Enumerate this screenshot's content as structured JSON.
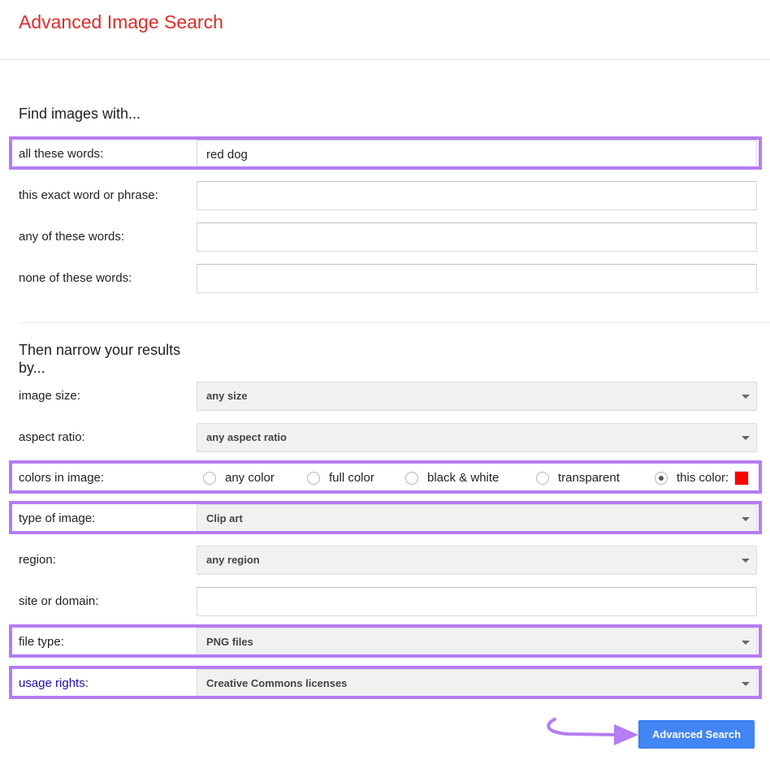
{
  "header": {
    "title": "Advanced Image Search",
    "title_color": "#dd2c2a"
  },
  "find_section": {
    "title": "Find images with...",
    "fields": [
      {
        "label": "all these words:",
        "value": "red dog",
        "placeholder": "",
        "highlighted": true
      },
      {
        "label": "this exact word or phrase:",
        "value": "",
        "placeholder": "",
        "highlighted": false
      },
      {
        "label": "any of these words:",
        "value": "",
        "placeholder": "",
        "highlighted": false
      },
      {
        "label": "none of these words:",
        "value": "",
        "placeholder": "",
        "highlighted": false
      }
    ]
  },
  "narrow_section": {
    "title": "Then narrow your results by...",
    "image_size": {
      "label": "image size:",
      "selected": "any size",
      "icon": "chevron-down-icon"
    },
    "aspect_ratio": {
      "label": "aspect ratio:",
      "selected": "any aspect ratio",
      "icon": "chevron-down-icon"
    },
    "colors": {
      "label": "colors in image:",
      "options": [
        {
          "label": "any color",
          "checked": false
        },
        {
          "label": "full color",
          "checked": false
        },
        {
          "label": "black & white",
          "checked": false
        },
        {
          "label": "transparent",
          "checked": false
        },
        {
          "label": "this color:",
          "checked": true
        }
      ],
      "selected_color": "#ff0000",
      "highlighted": true
    },
    "type_of_image": {
      "label": "type of image:",
      "selected": "Clip art",
      "highlighted": true,
      "icon": "chevron-down-icon"
    },
    "region": {
      "label": "region:",
      "selected": "any region",
      "icon": "chevron-down-icon"
    },
    "site_or_domain": {
      "label": "site or domain:",
      "value": ""
    },
    "file_type": {
      "label": "file type:",
      "selected": "PNG files",
      "highlighted": true,
      "icon": "chevron-down-icon"
    },
    "usage_rights": {
      "label_link": "usage rights",
      "label_suffix": ":",
      "selected": "Creative Commons licenses",
      "highlighted": true,
      "icon": "chevron-down-icon"
    }
  },
  "actions": {
    "submit_label": "Advanced Search",
    "submit_color": "#4285f4"
  },
  "annotations": {
    "highlight_color": "#b57cf3",
    "arrow_icon": "curved-arrow-icon"
  }
}
